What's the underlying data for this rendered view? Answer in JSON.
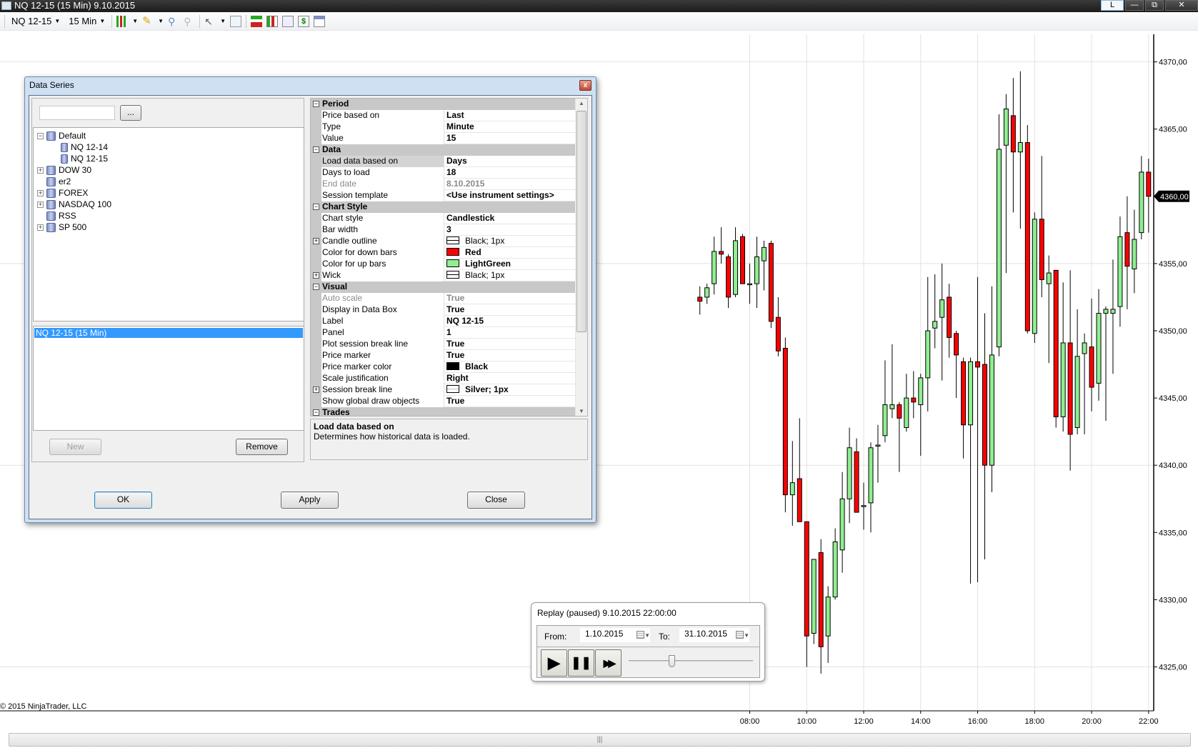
{
  "window": {
    "title": "NQ 12-15 (15 Min)  9.10.2015",
    "link_button": "L",
    "minimize": "—",
    "restore": "⧉",
    "close": "✕"
  },
  "toolbar": {
    "instrument": "NQ 12-15",
    "interval": "15 Min",
    "icons": [
      "bar-type-icon",
      "pencil-draw-icon",
      "zoom-in-icon",
      "zoom-out-icon",
      "cursor-icon",
      "search-data-box-icon",
      "strategy-icon",
      "indicators-icon",
      "chart-icon",
      "dollar-icon",
      "properties-icon"
    ]
  },
  "dialog": {
    "title": "Data Series",
    "close": "x",
    "search_value": "",
    "browse_label": "...",
    "tree": [
      {
        "label": "Default",
        "level": 0,
        "expander": "-"
      },
      {
        "label": "NQ 12-14",
        "level": 1,
        "expander": ""
      },
      {
        "label": "NQ 12-15",
        "level": 1,
        "expander": ""
      },
      {
        "label": "DOW 30",
        "level": 0,
        "expander": "+"
      },
      {
        "label": "er2",
        "level": 0,
        "expander": ""
      },
      {
        "label": "FOREX",
        "level": 0,
        "expander": "+"
      },
      {
        "label": "NASDAQ 100",
        "level": 0,
        "expander": "+"
      },
      {
        "label": "RSS",
        "level": 0,
        "expander": ""
      },
      {
        "label": "SP 500",
        "level": 0,
        "expander": "+"
      }
    ],
    "series": [
      "NQ 12-15 (15 Min)"
    ],
    "new_label": "New",
    "remove_label": "Remove",
    "properties": [
      {
        "cat": true,
        "label": "Period"
      },
      {
        "label": "Price based on",
        "value": "Last"
      },
      {
        "label": "Type",
        "value": "Minute"
      },
      {
        "label": "Value",
        "value": "15"
      },
      {
        "cat": true,
        "label": "Data"
      },
      {
        "label": "Load data based on",
        "value": "Days",
        "selected": true
      },
      {
        "label": "Days to load",
        "value": "18"
      },
      {
        "label": "End date",
        "value": "8.10.2015",
        "dim": true
      },
      {
        "label": "Session template",
        "value": "<Use instrument settings>"
      },
      {
        "cat": true,
        "label": "Chart Style"
      },
      {
        "label": "Chart style",
        "value": "Candlestick"
      },
      {
        "label": "Bar width",
        "value": "3"
      },
      {
        "label": "Candle outline",
        "value": "Black; 1px",
        "expand": true,
        "swatch": "line",
        "normal": true
      },
      {
        "label": "Color for down bars",
        "value": "Red",
        "swatch": "#ff0000"
      },
      {
        "label": "Color for up bars",
        "value": "LightGreen",
        "swatch": "#90ee90"
      },
      {
        "label": "Wick",
        "value": "Black; 1px",
        "expand": true,
        "swatch": "line",
        "normal": true
      },
      {
        "cat": true,
        "label": "Visual"
      },
      {
        "label": "Auto scale",
        "value": "True",
        "dim": true
      },
      {
        "label": "Display in Data Box",
        "value": "True"
      },
      {
        "label": "Label",
        "value": "NQ 12-15"
      },
      {
        "label": "Panel",
        "value": "1"
      },
      {
        "label": "Plot session break line",
        "value": "True"
      },
      {
        "label": "Price marker",
        "value": "True"
      },
      {
        "label": "Price marker color",
        "value": "Black",
        "swatch": "#000000"
      },
      {
        "label": "Scale justification",
        "value": "Right"
      },
      {
        "label": "Session break line",
        "value": "Silver; 1px",
        "expand": true,
        "swatch": "silverline"
      },
      {
        "label": "Show global draw objects",
        "value": "True"
      },
      {
        "cat": true,
        "label": "Trades"
      }
    ],
    "description_title": "Load data based on",
    "description_text": "Determines how historical data is loaded.",
    "ok_label": "OK",
    "apply_label": "Apply",
    "close_label": "Close"
  },
  "replay": {
    "status": "Replay (paused) 9.10.2015 22:00:00",
    "from_label": "From:",
    "from_value": "1.10.2015",
    "to_label": "To:",
    "to_value": "31.10.2015",
    "play": "▶",
    "pause": "❚❚",
    "fast_forward": "▶▶",
    "speed_fraction": 0.33
  },
  "copyright": "© 2015 NinjaTrader, LLC",
  "colors": {
    "up": "#90ee90",
    "down": "#ff0000",
    "grid": "#e2e2e2"
  },
  "chart_data": {
    "type": "candlestick",
    "instrument": "NQ 12-15",
    "interval_minutes": 15,
    "ylim": [
      4322,
      4373
    ],
    "y_ticks": [
      "4325,00",
      "4330,00",
      "4335,00",
      "4340,00",
      "4345,00",
      "4350,00",
      "4355,00",
      "4360,00",
      "4365,00",
      "4370,00"
    ],
    "y_tick_values": [
      4325,
      4330,
      4335,
      4340,
      4345,
      4350,
      4355,
      4360,
      4365,
      4370
    ],
    "x_ticks": [
      "08:00",
      "10:00",
      "12:00",
      "14:00",
      "16:00",
      "18:00",
      "20:00",
      "22:00"
    ],
    "x_tick_bar_index": [
      7,
      15,
      23,
      31,
      39,
      47,
      55,
      63
    ],
    "price_marker": {
      "value": 4360,
      "label": "4360,00"
    },
    "ohlc": [
      [
        4352.5,
        4353.3,
        4351.2,
        4352.2
      ],
      [
        4352.5,
        4353.5,
        4352.0,
        4353.2
      ],
      [
        4353.5,
        4357.0,
        4352.7,
        4355.9
      ],
      [
        4355.9,
        4357.7,
        4355.0,
        4355.7
      ],
      [
        4355.5,
        4355.7,
        4351.7,
        4352.5
      ],
      [
        4352.7,
        4357.7,
        4352.5,
        4356.7
      ],
      [
        4357.0,
        4357.2,
        4353.5,
        4353.5
      ],
      [
        4353.5,
        4355.0,
        4352.0,
        4353.5
      ],
      [
        4353.5,
        4357.0,
        4351.7,
        4355.5
      ],
      [
        4355.2,
        4356.7,
        4353.0,
        4356.2
      ],
      [
        4356.5,
        4356.7,
        4350.2,
        4350.7
      ],
      [
        4351.0,
        4352.5,
        4348.1,
        4348.5
      ],
      [
        4348.7,
        4349.5,
        4336.5,
        4337.8
      ],
      [
        4337.8,
        4341.8,
        4335.5,
        4338.7
      ],
      [
        4339.0,
        4343.5,
        4335.8,
        4335.8
      ],
      [
        4335.8,
        4335.8,
        4325.0,
        4327.3
      ],
      [
        4327.5,
        4333.0,
        4326.7,
        4333.0
      ],
      [
        4333.5,
        4334.5,
        4324.5,
        4326.5
      ],
      [
        4327.3,
        4331.0,
        4325.3,
        4330.2
      ],
      [
        4330.2,
        4335.3,
        4330.0,
        4334.3
      ],
      [
        4333.7,
        4339.5,
        4332.0,
        4337.5
      ],
      [
        4337.5,
        4342.8,
        4335.7,
        4341.3
      ],
      [
        4341.0,
        4342.0,
        4336.5,
        4336.5
      ],
      [
        4337.0,
        4338.7,
        4335.2,
        4337.0
      ],
      [
        4337.2,
        4341.7,
        4335.0,
        4341.3
      ],
      [
        4341.5,
        4343.0,
        4338.7,
        4341.5
      ],
      [
        4342.2,
        4347.8,
        4341.7,
        4344.5
      ],
      [
        4344.2,
        4349.0,
        4343.5,
        4344.5
      ],
      [
        4344.5,
        4344.7,
        4339.5,
        4343.5
      ],
      [
        4342.8,
        4346.8,
        4342.5,
        4345.0
      ],
      [
        4345.0,
        4347.0,
        4343.5,
        4344.7
      ],
      [
        4344.5,
        4346.8,
        4340.7,
        4346.5
      ],
      [
        4346.5,
        4354.0,
        4344.0,
        4350.0
      ],
      [
        4350.2,
        4354.2,
        4348.7,
        4350.7
      ],
      [
        4351.0,
        4355.0,
        4346.3,
        4352.3
      ],
      [
        4352.5,
        4353.5,
        4348.0,
        4349.5
      ],
      [
        4349.8,
        4350.0,
        4345.0,
        4348.2
      ],
      [
        4347.7,
        4348.0,
        4340.5,
        4343.0
      ],
      [
        4343.0,
        4348.0,
        4331.2,
        4347.7
      ],
      [
        4347.7,
        4354.0,
        4331.3,
        4347.3
      ],
      [
        4347.5,
        4351.3,
        4333.0,
        4340.0
      ],
      [
        4340.0,
        4353.3,
        4338.0,
        4348.2
      ],
      [
        4348.8,
        4366.1,
        4348.1,
        4363.5
      ],
      [
        4363.8,
        4367.6,
        4354.3,
        4366.5
      ],
      [
        4366.0,
        4368.8,
        4358.8,
        4363.3
      ],
      [
        4363.3,
        4369.3,
        4357.6,
        4364.0
      ],
      [
        4364.0,
        4365.3,
        4349.8,
        4350.0
      ],
      [
        4349.8,
        4358.8,
        4349.1,
        4358.3
      ],
      [
        4358.3,
        4363.0,
        4352.5,
        4353.8
      ],
      [
        4353.5,
        4355.6,
        4347.6,
        4354.3
      ],
      [
        4354.5,
        4354.5,
        4342.8,
        4343.6
      ],
      [
        4343.6,
        4353.6,
        4342.5,
        4349.1
      ],
      [
        4349.1,
        4354.5,
        4339.6,
        4342.3
      ],
      [
        4342.8,
        4351.6,
        4342.3,
        4348.1
      ],
      [
        4348.3,
        4349.8,
        4342.3,
        4349.1
      ],
      [
        4348.8,
        4352.4,
        4344.0,
        4345.8
      ],
      [
        4346.1,
        4353.1,
        4344.8,
        4351.3
      ],
      [
        4351.3,
        4351.8,
        4343.3,
        4351.6
      ],
      [
        4351.3,
        4355.3,
        4346.8,
        4351.6
      ],
      [
        4351.8,
        4358.5,
        4350.3,
        4357.0
      ],
      [
        4357.3,
        4360.0,
        4351.6,
        4354.8
      ],
      [
        4354.6,
        4359.0,
        4352.8,
        4356.8
      ],
      [
        4357.3,
        4363.0,
        4356.8,
        4361.8
      ],
      [
        4361.8,
        4362.8,
        4357.3,
        4360.0
      ]
    ]
  }
}
